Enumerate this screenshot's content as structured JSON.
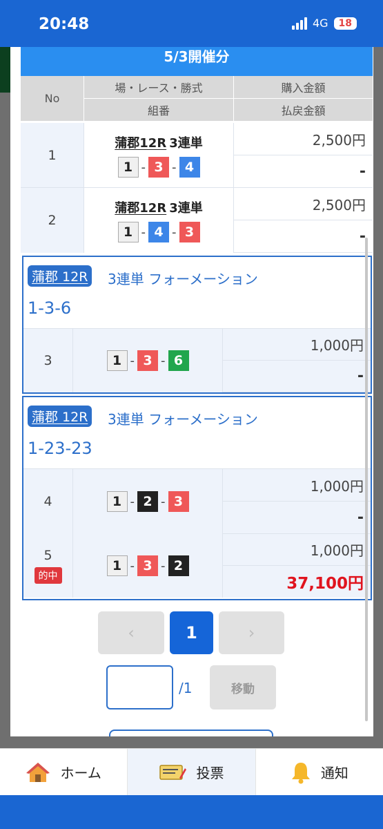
{
  "status": {
    "time": "20:48",
    "network": "4G",
    "battery": "18"
  },
  "header": {
    "date_title": "5/3開催分"
  },
  "table_header": {
    "no": "No",
    "race_type": "場・レース・勝式",
    "combination": "組番",
    "purchase": "購入金額",
    "payout": "払戻金額"
  },
  "rows": [
    {
      "no": "1",
      "venue": "蒲郡12R",
      "type": "3連単",
      "combo": [
        "1",
        "3",
        "4"
      ],
      "purchase": "2,500円",
      "payout": "-"
    },
    {
      "no": "2",
      "venue": "蒲郡12R",
      "type": "3連単",
      "combo": [
        "1",
        "4",
        "3"
      ],
      "purchase": "2,500円",
      "payout": "-"
    }
  ],
  "formations": [
    {
      "tag": "蒲郡 12R",
      "label": "3連単 フォーメーション",
      "combo_text": "1-3-6",
      "rows": [
        {
          "no": "3",
          "combo": [
            "1",
            "3",
            "6"
          ],
          "purchase": "1,000円",
          "payout": "-"
        }
      ]
    },
    {
      "tag": "蒲郡 12R",
      "label": "3連単 フォーメーション",
      "combo_text": "1-23-23",
      "rows": [
        {
          "no": "4",
          "combo": [
            "1",
            "2",
            "3"
          ],
          "purchase": "1,000円",
          "payout": "-"
        },
        {
          "no": "5",
          "badge": "的中",
          "combo": [
            "1",
            "3",
            "2"
          ],
          "purchase": "1,000円",
          "payout": "37,100円"
        }
      ]
    }
  ],
  "separator": "-",
  "pagination": {
    "prev": "‹",
    "current": "1",
    "next": "›",
    "total": "/1",
    "move": "移動"
  },
  "nav": {
    "home": "ホーム",
    "vote": "投票",
    "notify": "通知"
  },
  "colors": {
    "accent": "#1a66d2",
    "hit": "#e0141e"
  }
}
